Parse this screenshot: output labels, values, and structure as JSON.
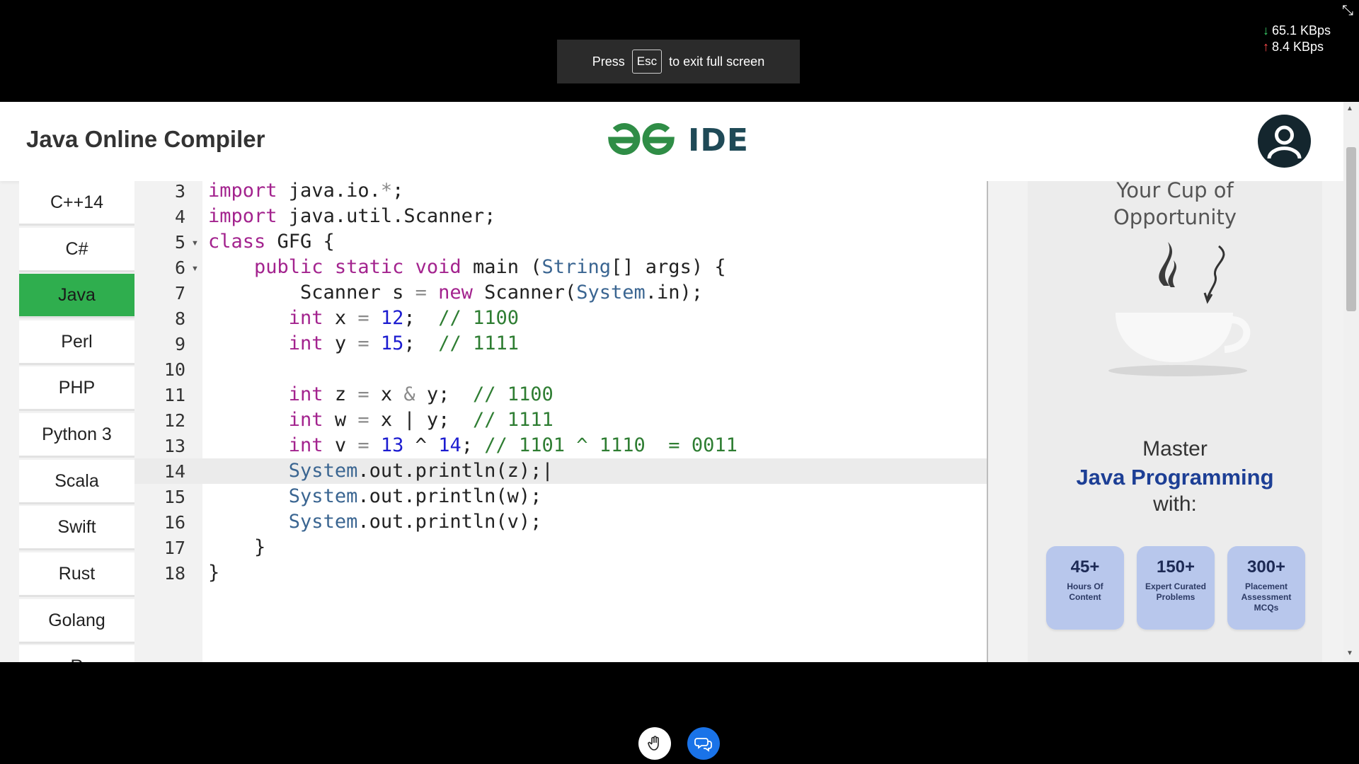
{
  "fullscreen_toast": {
    "press": "Press",
    "key": "Esc",
    "rest": "to exit full screen"
  },
  "network": {
    "down": "65.1 KBps",
    "up": "8.4 KBps"
  },
  "header": {
    "title": "Java Online Compiler",
    "logo_text": "IDE"
  },
  "languages": [
    "C++14",
    "C#",
    "Java",
    "Perl",
    "PHP",
    "Python 3",
    "Scala",
    "Swift",
    "Rust",
    "Golang",
    "R"
  ],
  "active_language": "Java",
  "editor": {
    "line_numbers": [
      "3",
      "4",
      "5",
      "6",
      "7",
      "8",
      "9",
      "10",
      "11",
      "12",
      "13",
      "14",
      "15",
      "16",
      "17",
      "18"
    ],
    "active_line": "14"
  },
  "ad": {
    "tagline_1": "Your Cup of",
    "tagline_2": "Opportunity",
    "master": "Master",
    "java": "Java Programming",
    "with": "with:",
    "stats": [
      {
        "big": "45+",
        "small": "Hours Of Content"
      },
      {
        "big": "150+",
        "small": "Expert Curated Problems"
      },
      {
        "big": "300+",
        "small": "Placement Assessment MCQs"
      }
    ]
  }
}
